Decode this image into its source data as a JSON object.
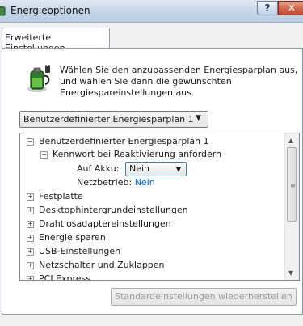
{
  "window": {
    "title": "Energieoptionen",
    "help_glyph": "?",
    "close_glyph": "✕"
  },
  "tabs": [
    {
      "label": "Erweiterte Einstellungen"
    }
  ],
  "description": "Wählen Sie den anzupassenden Energiesparplan aus, und wählen Sie dann die gewünschten Energiespareinstellungen aus.",
  "plan_select": {
    "value": "Benutzerdefinierter Energiesparplan 1"
  },
  "tree": {
    "plan": "Benutzerdefinierter Energiesparplan 1",
    "password_setting": "Kennwort bei Reaktivierung anfordern",
    "on_battery_label": "Auf Akku:",
    "on_battery_value": "Nein",
    "plugged_in_label": "Netzbetrieb:",
    "plugged_in_value": "Nein",
    "categories": [
      "Festplatte",
      "Desktophintergrundeinstellungen",
      "Drahtlosadaptereinstellungen",
      "Energie sparen",
      "USB-Einstellungen",
      "Netzschalter und Zuklappen",
      "PCI Express"
    ]
  },
  "buttons": {
    "restore": "Standardeinstellungen wiederherstellen"
  },
  "icons": {
    "app": "power-options-icon",
    "big": "battery-plug-icon"
  },
  "colors": {
    "link": "#0066cc",
    "titlebar": "#c7d6e8",
    "close": "#c04a30"
  }
}
